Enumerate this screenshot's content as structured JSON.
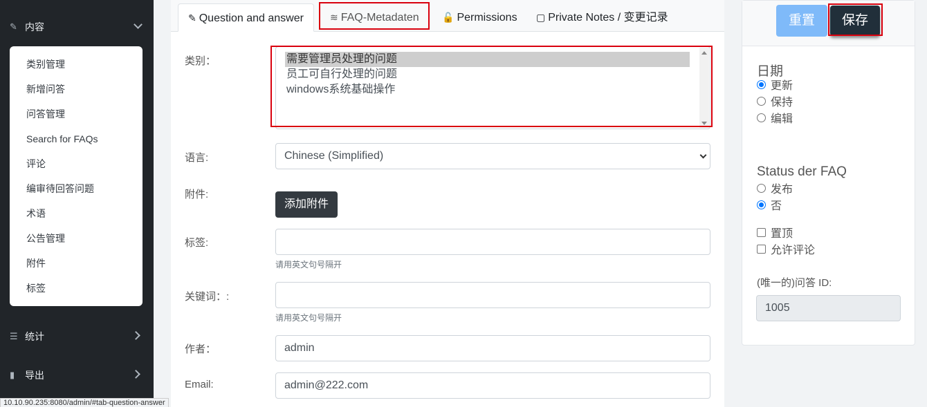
{
  "sidebar": {
    "content_header": "内容",
    "content_items": [
      "类别管理",
      "新增问答",
      "问答管理",
      "Search for FAQs",
      "评论",
      "编审待回答问题",
      "术语",
      "公告管理",
      "附件",
      "标签"
    ],
    "stats_header": "统计",
    "export_header": "导出"
  },
  "status_url": "10.10.90.235:8080/admin/#tab-question-answer",
  "tabs": {
    "qa": "Question and answer",
    "meta": "FAQ-Metadaten",
    "perm": "Permissions",
    "notes": "Private Notes / 变更记录"
  },
  "form": {
    "category_label": "类别：",
    "categories": [
      "需要管理员处理的问题",
      "员工可自行处理的问题",
      "windows系统基础操作"
    ],
    "selected_category": "需要管理员处理的问题",
    "language_label": "语言:",
    "language_value": "Chinese (Simplified)",
    "attachment_label": "附件:",
    "attachment_button": "添加附件",
    "tags_label": "标签:",
    "tags_value": "",
    "tags_hint": "请用英文句号隔开",
    "keywords_label": "关键词：:",
    "keywords_value": "",
    "keywords_hint": "请用英文句号隔开",
    "author_label": "作者：",
    "author_value": "admin",
    "email_label": "Email:",
    "email_value": "admin@222.com"
  },
  "right": {
    "reset_label": "重置",
    "save_label": "保存",
    "date_title": "日期",
    "date_options": [
      "更新",
      "保持",
      "编辑"
    ],
    "date_selected": "更新",
    "status_title": "Status der FAQ",
    "status_options": [
      "发布",
      "否"
    ],
    "status_selected": "否",
    "sticky_label": "置顶",
    "sticky_checked": false,
    "comments_label": "允许评论",
    "comments_checked": false,
    "id_label": "(唯一的)问答 ID:",
    "id_value": "1005"
  },
  "colors": {
    "sidebar_bg": "#212529",
    "highlight_red": "#d9000d",
    "reset_btn": "#7fbaf9",
    "save_btn": "#212f3a",
    "radio_blue": "#0075ff"
  },
  "icons": {
    "content": "edit-icon",
    "stats": "list-icon",
    "export": "file-icon",
    "qa_tab": "edit-icon",
    "meta_tab": "database-icon",
    "perm_tab": "lock-icon",
    "notes_tab": "note-icon"
  }
}
